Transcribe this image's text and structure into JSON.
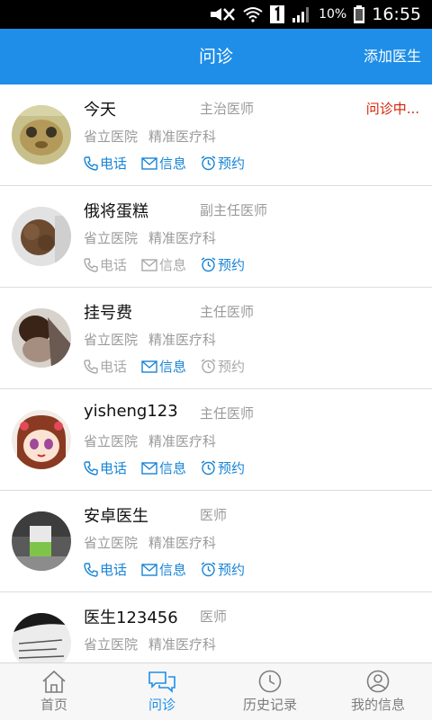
{
  "status_bar": {
    "battery": "10%",
    "time": "16:55"
  },
  "header": {
    "title": "问诊",
    "add_doctor": "添加医生"
  },
  "actions": {
    "phone": "电话",
    "message": "信息",
    "appointment": "预约"
  },
  "doctors": [
    {
      "name": "今天",
      "rank": "主治医师",
      "status": "问诊中...",
      "hospital": "省立医院",
      "department": "精准医疗科",
      "phone_on": true,
      "message_on": true,
      "appt_on": true
    },
    {
      "name": "俄将蛋糕",
      "rank": "副主任医师",
      "status": "",
      "hospital": "省立医院",
      "department": "精准医疗科",
      "phone_on": false,
      "message_on": false,
      "appt_on": true
    },
    {
      "name": "挂号费",
      "rank": "主任医师",
      "status": "",
      "hospital": "省立医院",
      "department": "精准医疗科",
      "phone_on": false,
      "message_on": true,
      "appt_on": false
    },
    {
      "name": "yisheng123",
      "rank": "主任医师",
      "status": "",
      "hospital": "省立医院",
      "department": "精准医疗科",
      "phone_on": true,
      "message_on": true,
      "appt_on": true
    },
    {
      "name": "安卓医生",
      "rank": "医师",
      "status": "",
      "hospital": "省立医院",
      "department": "精准医疗科",
      "phone_on": true,
      "message_on": true,
      "appt_on": true
    },
    {
      "name": "医生123456",
      "rank": "医师",
      "status": "",
      "hospital": "省立医院",
      "department": "精准医疗科",
      "phone_on": true,
      "message_on": true,
      "appt_on": true
    }
  ],
  "tabs": [
    {
      "label": "首页",
      "active": false
    },
    {
      "label": "问诊",
      "active": true
    },
    {
      "label": "历史记录",
      "active": false
    },
    {
      "label": "我的信息",
      "active": false
    }
  ],
  "colors": {
    "primary": "#1e8ee8",
    "active_action": "#1784d6",
    "inactive_action": "#a8a8a8",
    "status": "#d81e06"
  }
}
